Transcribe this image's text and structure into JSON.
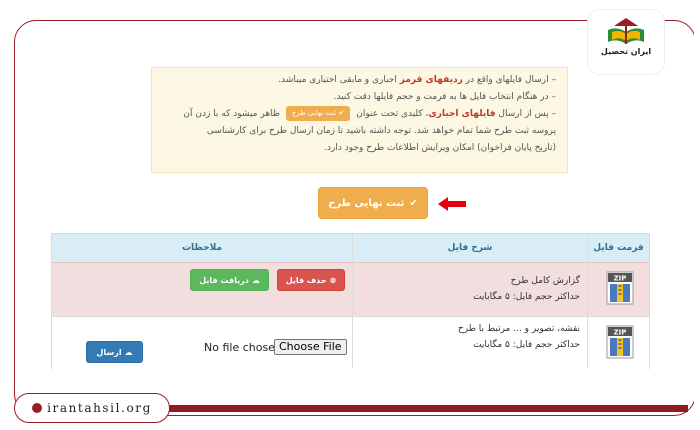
{
  "brand": {
    "logo_text": "ایران تحصیل",
    "footer_url": "irantahsil.org",
    "accent": "#9b1c24"
  },
  "info": {
    "line1_prefix": "– ارسال فایلهای واقع در ",
    "line1_red": "ردیفهای قرمز",
    "line1_suffix": " اجباری و مابقی اختیاری میباشد.",
    "line2": "– در هنگام انتخاب فایل ها به فرمت و حجم فایلها دقت کنید.",
    "line3_prefix": "– پس از ارسال ",
    "line3_red": "فایلهای اجباری",
    "line3_mid": "، کلیدی تحت عنوان ",
    "line3_button": "ثبت نهایی طرح",
    "line3_suffix": " ظاهر میشود که با زدن آن",
    "line4": "پروسه ثبت طرح شما تمام خواهد شد. توجه داشته باشید تا زمان ارسال طرح برای کارشناسی",
    "line5": "(تاریخ پایان فراخوان) امکان ویرایش اطلاعات طرح وجود دارد."
  },
  "final_button": {
    "label": "ثبت نهایی طرح",
    "color": "#f0ad4e"
  },
  "table": {
    "headers": {
      "format": "فرمت فایل",
      "description": "شرح فایل",
      "notes": "ملاحظات"
    },
    "rows": [
      {
        "icon": "zip-file-icon",
        "title": "گزارش کامل طرح",
        "size": "حداکثر حجم فایل: ۵ مگابایت",
        "delete_label": "حذف فایل",
        "download_label": "دریافت فایل",
        "required": true
      },
      {
        "icon": "zip-file-icon",
        "title": "نقشه، تصویر و ... مرتبط با طرح",
        "size": "حداکثر حجم فایل: ۵ مگابایت",
        "no_file": "No file chosen",
        "choose_label": "Choose File",
        "send_label": "ارسال",
        "required": false
      }
    ]
  }
}
